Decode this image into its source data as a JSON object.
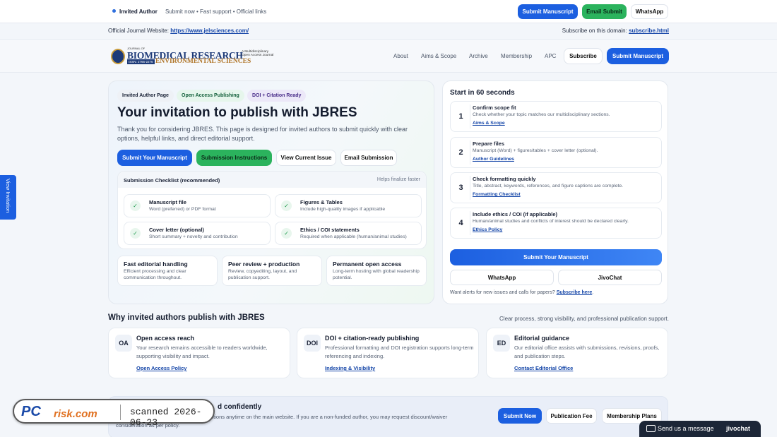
{
  "topbar": {
    "invited": "Invited Author",
    "tagline": "Submit now • Fast support • Official links",
    "submit": "Submit Manuscript",
    "email": "Email Submit",
    "whatsapp": "WhatsApp"
  },
  "subbar": {
    "website_label": "Official Journal Website:",
    "website_url": "https://www.jelsciences.com/",
    "subscribe_label": "Subscribe on this domain:",
    "subscribe_link": "subscribe.html"
  },
  "logo": {
    "journal_of": "JOURNAL OF",
    "line1": "BIOMEDICAL RESEARCH",
    "line2": "ENVIRONMENTAL SCIENCES",
    "issn": "ISSN: 2766-2276",
    "tag": "A Multidisciplinary Open Access Journal"
  },
  "nav": {
    "about": "About",
    "aims": "Aims & Scope",
    "archive": "Archive",
    "membership": "Membership",
    "apc": "APC",
    "subscribe": "Subscribe",
    "submit": "Submit Manuscript"
  },
  "hero": {
    "pills": [
      "Invited Author Page",
      "Open Access Publishing",
      "DOI + Citation Ready"
    ],
    "title": "Your invitation to publish with JBRES",
    "lead": "Thank you for considering JBRES. This page is designed for invited authors to submit quickly with clear options, helpful links, and direct editorial support.",
    "btn_submit": "Submit Your Manuscript",
    "btn_instructions": "Submission Instructions",
    "btn_issue": "View Current Issue",
    "btn_email": "Email Submission"
  },
  "checklist": {
    "title": "Submission Checklist (recommended)",
    "hint": "Helps finalize faster",
    "items": [
      {
        "t": "Manuscript file",
        "d": "Word (preferred) or PDF format"
      },
      {
        "t": "Figures & Tables",
        "d": "Include high-quality images if applicable"
      },
      {
        "t": "Cover letter (optional)",
        "d": "Short summary + novelty and contribution"
      },
      {
        "t": "Ethics / COI statements",
        "d": "Required when applicable (human/animal studies)"
      }
    ]
  },
  "features": [
    {
      "t": "Fast editorial handling",
      "d": "Efficient processing and clear communication throughout."
    },
    {
      "t": "Peer review + production",
      "d": "Review, copyediting, layout, and publication support."
    },
    {
      "t": "Permanent open access",
      "d": "Long-term hosting with global readership potential."
    }
  ],
  "start": {
    "title": "Start in 60 seconds",
    "steps": [
      {
        "n": "1",
        "t": "Confirm scope fit",
        "d": "Check whether your topic matches our multidisciplinary sections.",
        "link": "Aims & Scope"
      },
      {
        "n": "2",
        "t": "Prepare files",
        "d": "Manuscript (Word) + figures/tables + cover letter (optional).",
        "link": "Author Guidelines"
      },
      {
        "n": "3",
        "t": "Check formatting quickly",
        "d": "Title, abstract, keywords, references, and figure captions are complete.",
        "link": "Formatting Checklist"
      },
      {
        "n": "4",
        "t": "Include ethics / COI (if applicable)",
        "d": "Human/animal studies and conflicts of interest should be declared clearly.",
        "link": "Ethics Policy"
      }
    ],
    "submit": "Submit Your Manuscript",
    "whatsapp": "WhatsApp",
    "jivochat": "JivoChat",
    "alerts": "Want alerts for new issues and calls for papers?",
    "alerts_link": "Subscribe here",
    "alerts_end": "."
  },
  "why": {
    "title": "Why invited authors publish with JBRES",
    "right": "Clear process, strong visibility, and professional publication support.",
    "cards": [
      {
        "icon": "OA",
        "t": "Open access reach",
        "d": "Your research remains accessible to readers worldwide, supporting visibility and impact.",
        "link": "Open Access Policy"
      },
      {
        "icon": "DOI",
        "t": "DOI + citation-ready publishing",
        "d": "Professional formatting and DOI registration supports long-term referencing and indexing.",
        "link": "Indexing & Visibility"
      },
      {
        "icon": "ED",
        "t": "Editorial guidance",
        "d": "Our editorial office assists with submissions, revisions, proofs, and publication steps.",
        "link": "Contact Editorial Office"
      }
    ]
  },
  "bottom": {
    "title_tail": "d confidently",
    "text_tail": "ptions anytime on the main website. If you are a non-funded author, you may request discount/waiver",
    "text2": "consideration as per policy.",
    "btn_submit": "Submit Now",
    "btn_fee": "Publication Fee",
    "btn_plans": "Membership Plans"
  },
  "side_tab": "View Invitation",
  "watermark": {
    "pc": "PC",
    "risk": "risk.com",
    "scanned": "scanned 2026-06-23"
  },
  "chat": {
    "send": "Send us a message",
    "brand": "jivochat"
  }
}
